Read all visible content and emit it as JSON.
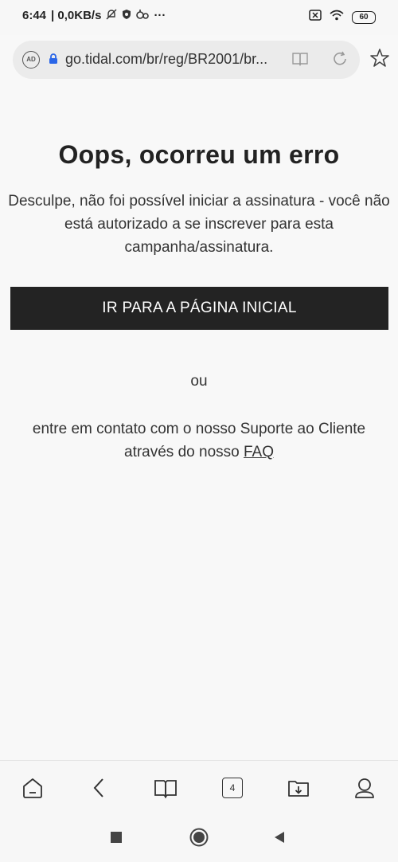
{
  "status_bar": {
    "time": "6:44",
    "net_speed": "| 0,0KB/s",
    "more": "···",
    "battery": "60"
  },
  "browser": {
    "url": "go.tidal.com/br/reg/BR2001/br...",
    "shield_label": "AD",
    "tab_count": "4"
  },
  "page": {
    "title": "Oops, ocorreu um erro",
    "description": "Desculpe, não foi possível iniciar a assinatura - você não está autorizado a se inscrever para esta campanha/assinatura.",
    "home_button": "IR PARA A PÁGINA INICIAL",
    "or": "ou",
    "contact_text": "entre em contato com o nosso Suporte ao Cliente através do nosso",
    "faq_link": "FAQ"
  }
}
